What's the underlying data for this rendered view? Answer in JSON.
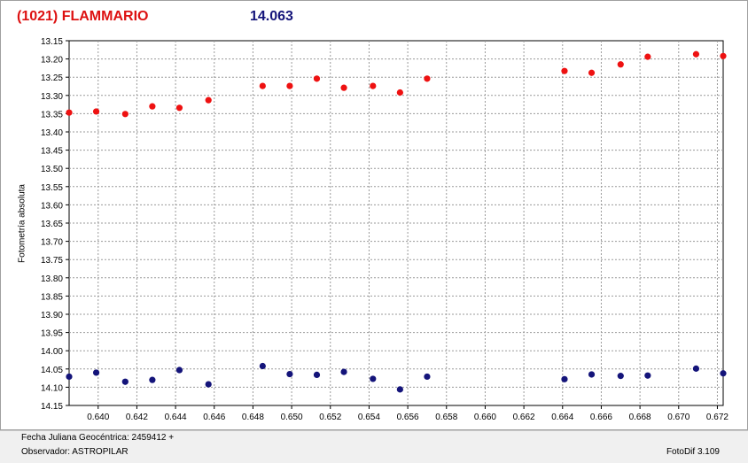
{
  "header": {
    "object_name": "(1021) FLAMMARIO",
    "magnitude": "14.063"
  },
  "footer": {
    "julian_date": "Fecha Juliana Geocéntrica: 2459412 +",
    "observer": "Observador: ASTROPILAR",
    "version": "FotoDif 3.109"
  },
  "colors": {
    "series1": "#ee1111",
    "series2": "#14147a",
    "grid": "#9a9a9a"
  },
  "chart_data": {
    "type": "scatter",
    "title": "(1021) FLAMMARIO",
    "xlabel": "Fecha Juliana Geocéntrica: 2459412 +",
    "ylabel": "Fotometría absoluta",
    "xlim": [
      0.6385,
      0.6723
    ],
    "ylim": [
      13.15,
      14.15
    ],
    "y_inverted": true,
    "grid": true,
    "xticks": [
      "0.640",
      "0.642",
      "0.644",
      "0.646",
      "0.648",
      "0.650",
      "0.652",
      "0.654",
      "0.656",
      "0.658",
      "0.660",
      "0.662",
      "0.664",
      "0.666",
      "0.668",
      "0.670",
      "0.672"
    ],
    "yticks": [
      "13.15",
      "13.20",
      "13.25",
      "13.30",
      "13.35",
      "13.40",
      "13.45",
      "13.50",
      "13.55",
      "13.60",
      "13.65",
      "13.70",
      "13.75",
      "13.80",
      "13.85",
      "13.90",
      "13.95",
      "14.00",
      "14.05",
      "14.10",
      "14.15"
    ],
    "series": [
      {
        "color": "#ee1111",
        "x": [
          0.6385,
          0.6399,
          0.6414,
          0.6428,
          0.6442,
          0.6457,
          0.6485,
          0.6499,
          0.6513,
          0.6527,
          0.6542,
          0.6556,
          0.657,
          0.6641,
          0.6655,
          0.667,
          0.6684,
          0.6709,
          0.6723
        ],
        "y": [
          13.347,
          13.344,
          13.351,
          13.33,
          13.334,
          13.313,
          13.274,
          13.274,
          13.254,
          13.279,
          13.274,
          13.292,
          13.254,
          13.233,
          13.238,
          13.215,
          13.194,
          13.187,
          13.192
        ]
      },
      {
        "color": "#14147a",
        "x": [
          0.6385,
          0.6399,
          0.6414,
          0.6428,
          0.6442,
          0.6457,
          0.6485,
          0.6499,
          0.6513,
          0.6527,
          0.6542,
          0.6556,
          0.657,
          0.6641,
          0.6655,
          0.667,
          0.6684,
          0.6709,
          0.6723
        ],
        "y": [
          14.071,
          14.06,
          14.085,
          14.08,
          14.053,
          14.092,
          14.042,
          14.064,
          14.066,
          14.058,
          14.077,
          14.106,
          14.071,
          14.078,
          14.065,
          14.069,
          14.068,
          14.049,
          14.062
        ]
      }
    ]
  }
}
